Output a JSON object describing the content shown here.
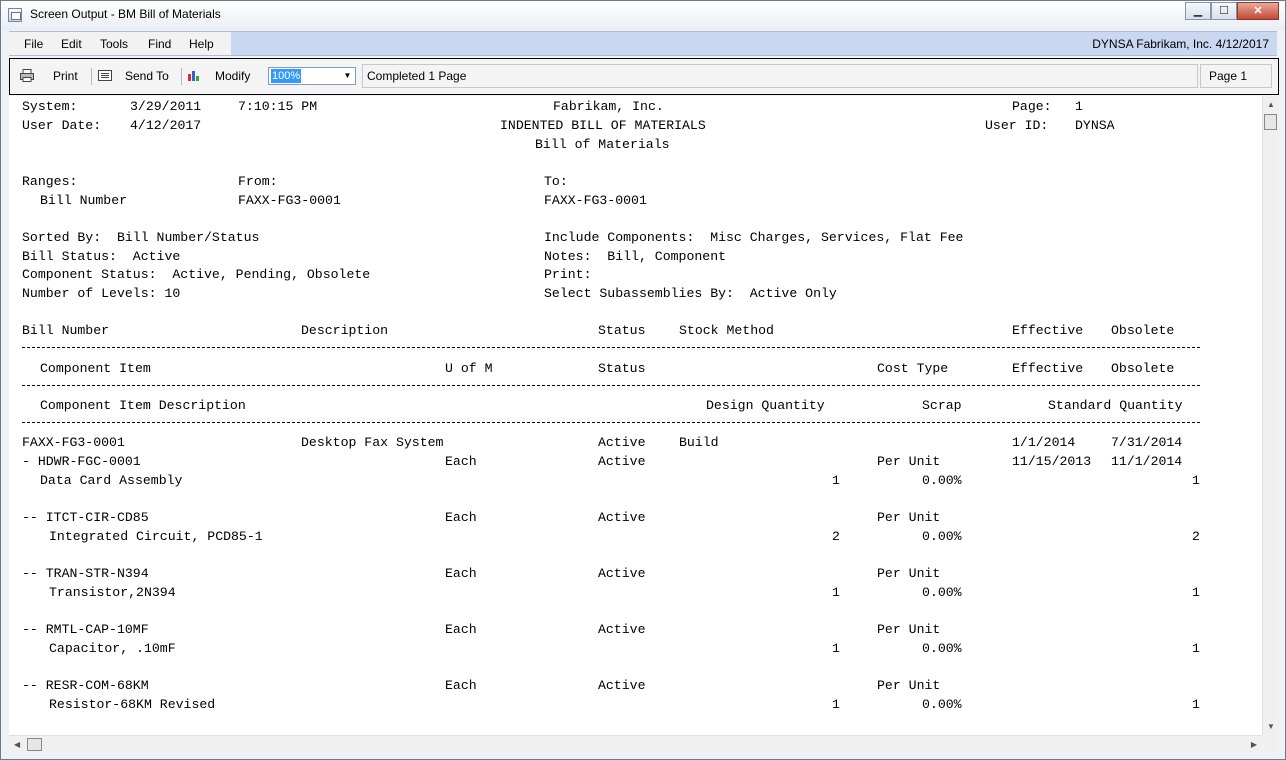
{
  "window": {
    "title": "Screen Output - BM Bill of Materials",
    "min_glyph": "▁",
    "max_glyph": "☐",
    "close_glyph": "✕"
  },
  "menu": {
    "items": [
      "File",
      "Edit",
      "Tools",
      "Find",
      "Help"
    ],
    "right_text": "DYNSA  Fabrikam, Inc.  4/12/2017"
  },
  "toolbar": {
    "print_label": "Print",
    "send_to_label": "Send To",
    "modify_label": "Modify",
    "zoom_value": "100%",
    "status_text": "Completed 1 Page",
    "page_text": "Page 1"
  },
  "report": {
    "header": {
      "system_label": "System:",
      "system_date": "3/29/2011",
      "system_time": "7:10:15 PM",
      "company": "Fabrikam, Inc.",
      "page_label": "Page:",
      "page_num": "1",
      "user_date_label": "User Date:",
      "user_date": "4/12/2017",
      "report_title": "INDENTED BILL OF MATERIALS",
      "user_id_label": "User ID:",
      "user_id": "DYNSA",
      "subtitle": "Bill of Materials"
    },
    "ranges": {
      "label": "Ranges:",
      "from_label": "From:",
      "to_label": "To:",
      "field": "Bill Number",
      "from": "FAXX-FG3-0001",
      "to": "FAXX-FG3-0001"
    },
    "options": {
      "sorted_by": "Sorted By:  Bill Number/Status",
      "bill_status": "Bill Status:  Active",
      "component_status": "Component Status:  Active, Pending, Obsolete",
      "levels": "Number of Levels: 10",
      "include": "Include Components:  Misc Charges, Services, Flat Fee",
      "notes": "Notes:  Bill, Component",
      "print": "Print:",
      "select_sub": "Select Subassemblies By:  Active Only"
    },
    "columns": {
      "bill_number": "Bill Number",
      "description": "Description",
      "status": "Status",
      "stock_method": "Stock Method",
      "effective": "Effective",
      "obsolete": "Obsolete",
      "component_item": "Component Item",
      "uofm": "U of M",
      "status2": "Status",
      "cost_type": "Cost Type",
      "effective2": "Effective",
      "obsolete2": "Obsolete",
      "component_desc": "Component Item Description",
      "design_qty": "Design Quantity",
      "scrap": "Scrap",
      "standard_qty": "Standard Quantity"
    },
    "bill": {
      "number": "FAXX-FG3-0001",
      "description": "Desktop Fax System",
      "status": "Active",
      "stock_method": "Build",
      "effective": "1/1/2014",
      "obsolete": "7/31/2014"
    },
    "components": [
      {
        "item": "- HDWR-FGC-0001",
        "uofm": "Each",
        "status": "Active",
        "cost_type": "Per Unit",
        "effective": "11/15/2013",
        "obsolete": "11/1/2014",
        "desc": "Data Card Assembly",
        "design_qty": "1",
        "scrap": "0.00%",
        "std_qty": "1"
      },
      {
        "item": "-- ITCT-CIR-CD85",
        "uofm": "Each",
        "status": "Active",
        "cost_type": "Per Unit",
        "effective": "",
        "obsolete": "",
        "desc": "Integrated Circuit, PCD85-1",
        "design_qty": "2",
        "scrap": "0.00%",
        "std_qty": "2"
      },
      {
        "item": "-- TRAN-STR-N394",
        "uofm": "Each",
        "status": "Active",
        "cost_type": "Per Unit",
        "effective": "",
        "obsolete": "",
        "desc": "Transistor,2N394",
        "design_qty": "1",
        "scrap": "0.00%",
        "std_qty": "1"
      },
      {
        "item": "-- RMTL-CAP-10MF",
        "uofm": "Each",
        "status": "Active",
        "cost_type": "Per Unit",
        "effective": "",
        "obsolete": "",
        "desc": "Capacitor, .10mF",
        "design_qty": "1",
        "scrap": "0.00%",
        "std_qty": "1"
      },
      {
        "item": "-- RESR-COM-68KM",
        "uofm": "Each",
        "status": "Active",
        "cost_type": "Per Unit",
        "effective": "",
        "obsolete": "",
        "desc": "Resistor-68KM Revised",
        "design_qty": "1",
        "scrap": "0.00%",
        "std_qty": "1"
      }
    ]
  },
  "colors": {
    "menu_bar": "#c9d7f0",
    "zoom_highlight": "#3399ff",
    "close_button": "#c24a33"
  }
}
